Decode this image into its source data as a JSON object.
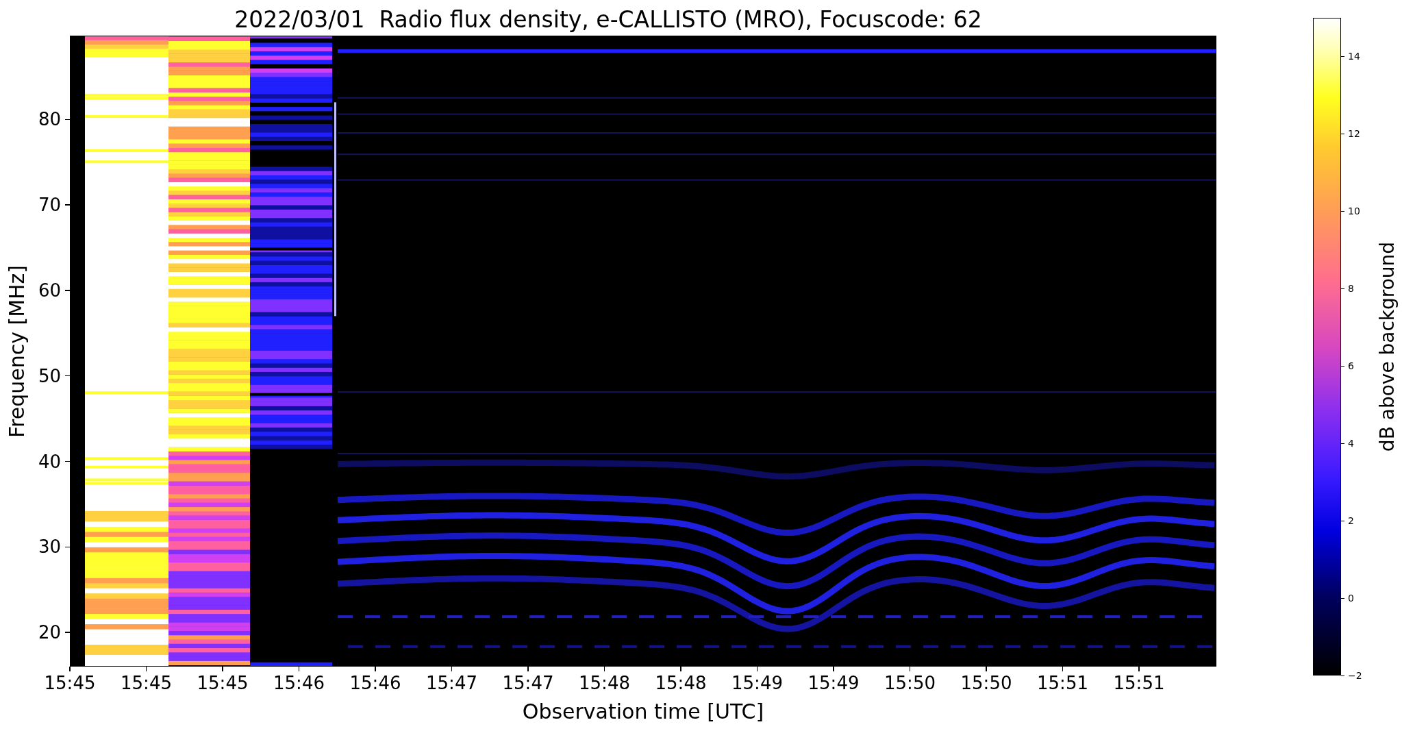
{
  "title": "2022/03/01  Radio flux density, e-CALLISTO (MRO), Focuscode: 62",
  "y_axis": {
    "label": "Frequency [MHz]",
    "ticks": [
      "80",
      "70",
      "60",
      "50",
      "40",
      "30",
      "20"
    ]
  },
  "x_axis": {
    "label": "Observation time [UTC]",
    "ticks": [
      "15:45",
      "15:45",
      "15:45",
      "15:46",
      "15:46",
      "15:47",
      "15:47",
      "15:48",
      "15:48",
      "15:49",
      "15:49",
      "15:50",
      "15:50",
      "15:51",
      "15:51"
    ]
  },
  "colorbar": {
    "label": "dB above background",
    "ticks": [
      "14",
      "12",
      "10",
      "8",
      "6",
      "4",
      "2",
      "0",
      "−2"
    ]
  }
}
